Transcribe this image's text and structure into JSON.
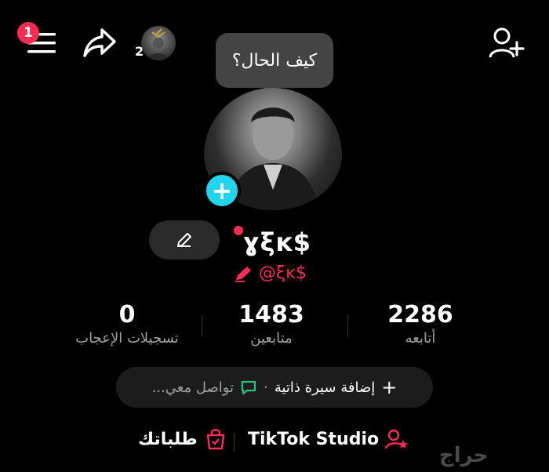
{
  "header": {
    "notification_count": "1",
    "story_count": "2"
  },
  "bubble": {
    "text": "كيف الحال؟"
  },
  "profile": {
    "display_name": "ɣξĸ$",
    "handle": "@ξĸ$"
  },
  "stats": [
    {
      "value": "2286",
      "label": "أتابعه"
    },
    {
      "value": "1483",
      "label": "متابعين"
    },
    {
      "value": "0",
      "label": "تسجيلات الإعجاب"
    }
  ],
  "bio": {
    "add_bio": "إضافة سيرة ذاتية",
    "separator": "·",
    "contact": "تواصل معي..."
  },
  "bottom": {
    "studio_label": "TikTok Studio",
    "orders_label": "طلباتك"
  },
  "watermark": "حراج",
  "colors": {
    "accent_red": "#fe2c55",
    "accent_cyan": "#20d5ec",
    "chat_green": "#25c37b"
  }
}
